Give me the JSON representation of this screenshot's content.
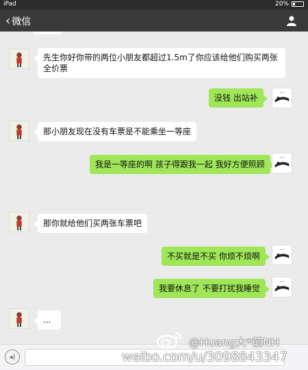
{
  "status_bar": {
    "device": "iPad",
    "time": "",
    "battery": "20%"
  },
  "nav": {
    "back_label": "微信"
  },
  "messages": [
    {
      "side": "left",
      "text": "先生你好你带的两位小朋友都超过1.5m了你应该给他们购买两张全价票"
    },
    {
      "side": "right",
      "text": "没钱 出站补"
    },
    {
      "side": "left",
      "text": "那小朋友现在没有车票是不能乘坐一等座"
    },
    {
      "side": "right",
      "text": "我是一等座的啊 孩子得跟我一起 我好方便照顾"
    },
    {
      "side": "left",
      "text": "那你就给他们买两张车票吧"
    },
    {
      "side": "right",
      "text": "不买就是不买 你烦不烦啊"
    },
    {
      "side": "right",
      "text": "我要休息了 不要打扰我睡觉"
    },
    {
      "side": "left",
      "text": "..."
    }
  ],
  "watermark": {
    "handle": "@Huang大*前NH",
    "url": "weibo.com/u/3098843347"
  },
  "colors": {
    "nav_bg": "#3a3a3a",
    "chat_bg": "#ebebeb",
    "right_bubble": "#9fe658",
    "left_bubble": "#ffffff"
  }
}
